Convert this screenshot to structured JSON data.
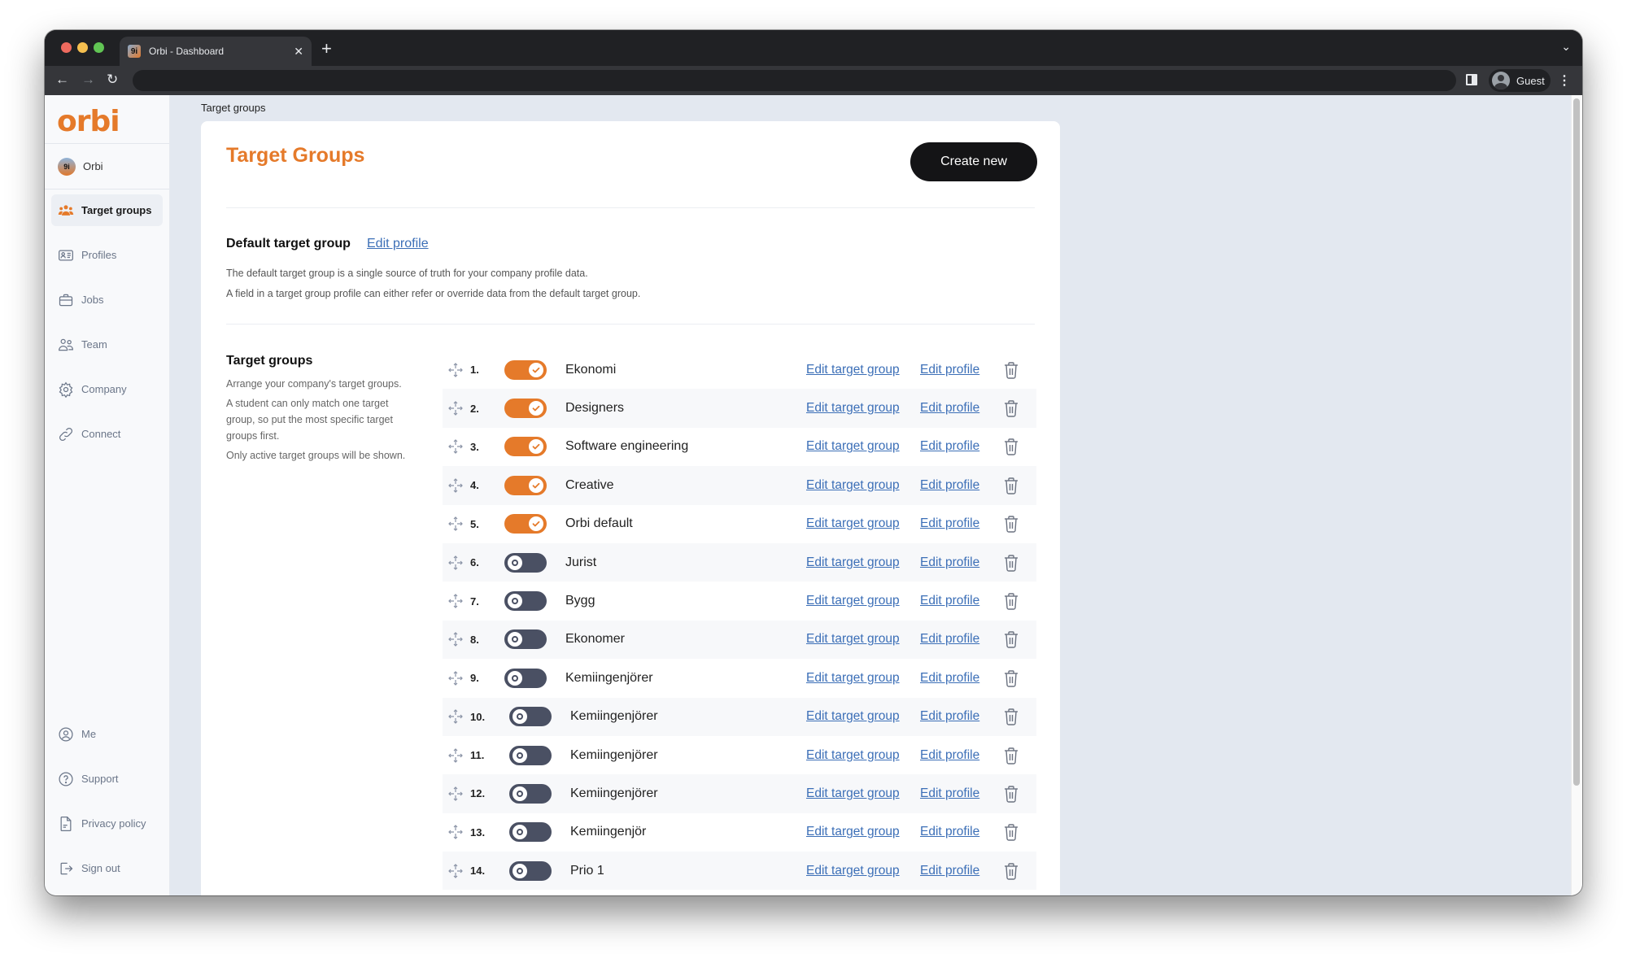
{
  "browser": {
    "tab_title": "Orbi - Dashboard",
    "favicon_label": "9i",
    "url": "",
    "profile_label": "Guest"
  },
  "sidebar": {
    "logo": "orbi",
    "org_name": "Orbi",
    "org_avatar_label": "9i",
    "items": [
      {
        "label": "Target groups",
        "icon": "people-group-icon",
        "active": true
      },
      {
        "label": "Profiles",
        "icon": "id-card-icon",
        "active": false
      },
      {
        "label": "Jobs",
        "icon": "briefcase-icon",
        "active": false
      },
      {
        "label": "Team",
        "icon": "users-icon",
        "active": false
      },
      {
        "label": "Company",
        "icon": "gear-icon",
        "active": false
      },
      {
        "label": "Connect",
        "icon": "link-icon",
        "active": false
      }
    ],
    "bottom_items": [
      {
        "label": "Me",
        "icon": "user-circle-icon"
      },
      {
        "label": "Support",
        "icon": "help-circle-icon"
      },
      {
        "label": "Privacy policy",
        "icon": "document-icon"
      },
      {
        "label": "Sign out",
        "icon": "sign-out-icon"
      }
    ]
  },
  "main": {
    "breadcrumb": "Target groups",
    "title": "Target Groups",
    "create_button": "Create new",
    "default_section": {
      "title": "Default target group",
      "link": "Edit profile",
      "desc_line1": "The default target group is a single source of truth for your company profile data.",
      "desc_line2": "A field in a target group profile can either refer or override data from the default target group."
    },
    "groups_section": {
      "title": "Target groups",
      "desc1": "Arrange your company's target groups.",
      "desc2": "A student can only match one target group, so put the most specific target groups first.",
      "desc3": "Only active target groups will be shown.",
      "edit_group_label": "Edit target group",
      "edit_profile_label": "Edit profile"
    },
    "target_groups": [
      {
        "index": "1.",
        "name": "Ekonomi",
        "active": true
      },
      {
        "index": "2.",
        "name": "Designers",
        "active": true
      },
      {
        "index": "3.",
        "name": "Software engineering",
        "active": true
      },
      {
        "index": "4.",
        "name": "Creative",
        "active": true
      },
      {
        "index": "5.",
        "name": "Orbi default",
        "active": true
      },
      {
        "index": "6.",
        "name": "Jurist",
        "active": false
      },
      {
        "index": "7.",
        "name": "Bygg",
        "active": false
      },
      {
        "index": "8.",
        "name": "Ekonomer",
        "active": false
      },
      {
        "index": "9.",
        "name": "Kemiingenjörer",
        "active": false
      },
      {
        "index": "10.",
        "name": "Kemiingenjörer",
        "active": false
      },
      {
        "index": "11.",
        "name": "Kemiingenjörer",
        "active": false
      },
      {
        "index": "12.",
        "name": "Kemiingenjörer",
        "active": false
      },
      {
        "index": "13.",
        "name": "Kemiingenjör",
        "active": false
      },
      {
        "index": "14.",
        "name": "Prio 1",
        "active": false
      }
    ]
  },
  "colors": {
    "accent": "#e57a2a",
    "toggle_off": "#4a5063",
    "link": "#3c6fb7",
    "button_dark": "#141416"
  }
}
